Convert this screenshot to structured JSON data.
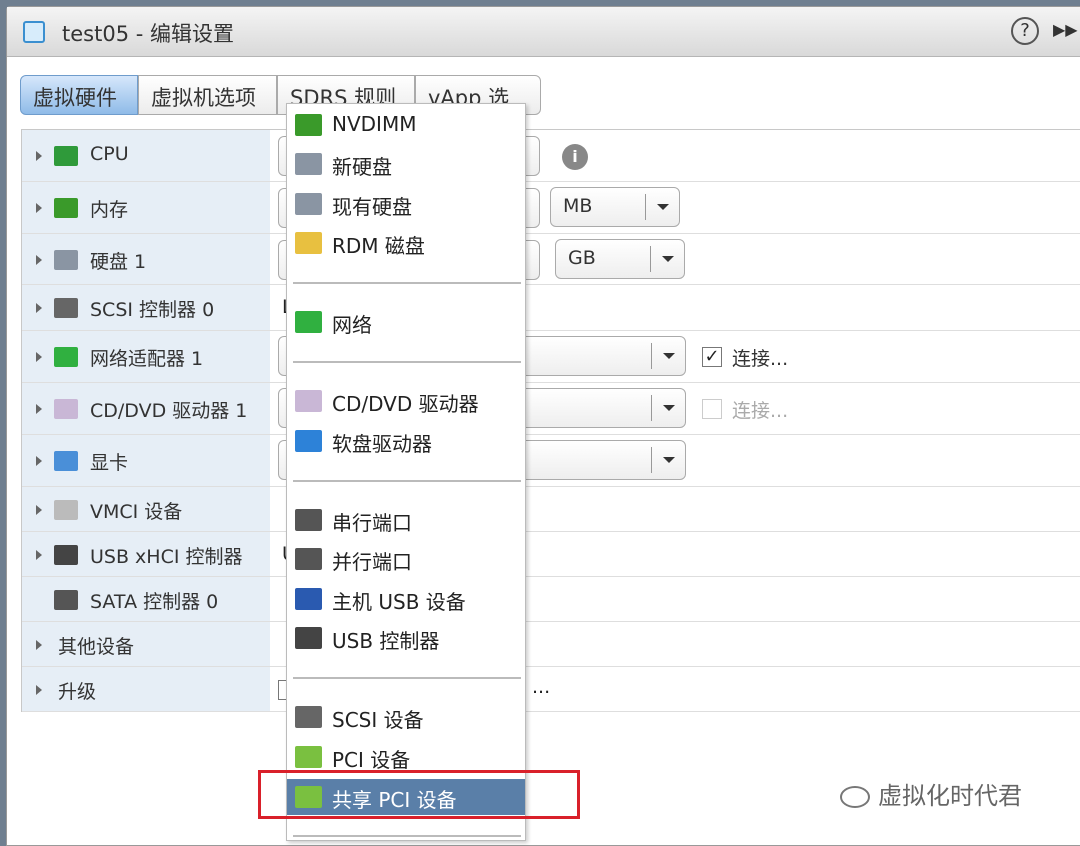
{
  "window": {
    "title": "test05 - 编辑设置",
    "help_icon": "?",
    "forward_icon": "▶▶"
  },
  "tabs": [
    {
      "label": "虚拟硬件",
      "active": true
    },
    {
      "label": "虚拟机选项"
    },
    {
      "label": "SDRS 规则"
    },
    {
      "label": "vApp 选项"
    }
  ],
  "hardware": [
    {
      "label": "CPU",
      "icon": "cpu-icon"
    },
    {
      "label": "内存",
      "icon": "memory-icon",
      "unit": "MB"
    },
    {
      "label": "硬盘 1",
      "icon": "disk-icon",
      "unit": "GB"
    },
    {
      "label": "SCSI 控制器 0",
      "icon": "scsi-icon",
      "value": "L"
    },
    {
      "label": "网络适配器 1",
      "icon": "network-icon",
      "connect": "连接...",
      "connected": true
    },
    {
      "label": "CD/DVD 驱动器 1",
      "icon": "cdrom-icon",
      "connect": "连接...",
      "connected": false
    },
    {
      "label": "显卡",
      "icon": "display-icon"
    },
    {
      "label": "VMCI 设备",
      "icon": "gear-icon"
    },
    {
      "label": "USB xHCI 控制器",
      "icon": "usb-icon",
      "value": "U"
    },
    {
      "label": "SATA 控制器 0",
      "icon": "sata-icon"
    },
    {
      "label": "其他设备"
    },
    {
      "label": "升级",
      "value": "..."
    }
  ],
  "menu": [
    {
      "label": "NVDIMM",
      "icon": "nvdimm-icon"
    },
    {
      "label": "新硬盘",
      "icon": "disk-icon"
    },
    {
      "label": "现有硬盘",
      "icon": "disk-icon"
    },
    {
      "label": "RDM 磁盘",
      "icon": "rdm-icon"
    },
    {
      "label": "网络",
      "icon": "network-icon"
    },
    {
      "label": "CD/DVD 驱动器",
      "icon": "cdrom-icon"
    },
    {
      "label": "软盘驱动器",
      "icon": "floppy-icon"
    },
    {
      "label": "串行端口",
      "icon": "serial-port-icon"
    },
    {
      "label": "并行端口",
      "icon": "parallel-port-icon"
    },
    {
      "label": "主机 USB 设备",
      "icon": "usb-stick-icon"
    },
    {
      "label": "USB 控制器",
      "icon": "usb-icon"
    },
    {
      "label": "SCSI 设备",
      "icon": "scsi-icon"
    },
    {
      "label": "PCI 设备",
      "icon": "pci-icon"
    },
    {
      "label": "共享 PCI 设备",
      "icon": "pci-icon",
      "highlighted": true
    }
  ],
  "watermark": "虚拟化时代君",
  "colors": {
    "highlight": "#5a7fa8",
    "annotation": "#d9202a",
    "active_tab": "#8fbbe8"
  }
}
